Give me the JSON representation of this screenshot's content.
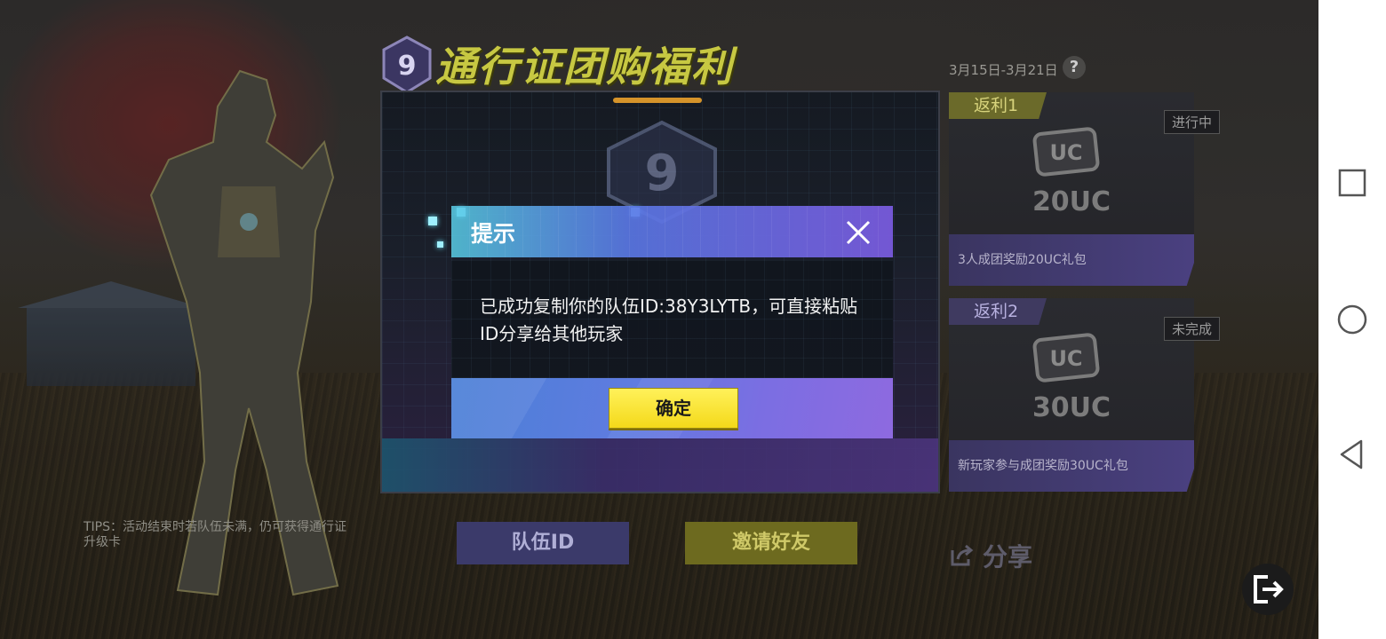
{
  "header": {
    "title": "通行证团购福利",
    "date_range": "3月15日-3月21日",
    "help_icon": "question-icon"
  },
  "rewards": [
    {
      "tag": "返利1",
      "status": "进行中",
      "amount": "20UC",
      "description": "3人成团奖励20UC礼包",
      "icon": "uc-icon"
    },
    {
      "tag": "返利2",
      "status": "未完成",
      "amount": "30UC",
      "description": "新玩家参与成团奖励30UC礼包",
      "icon": "uc-icon"
    }
  ],
  "tips": "TIPS：活动结束时若队伍未满，仍可获得通行证升级卡",
  "buttons": {
    "team_id": "队伍ID",
    "invite_friends": "邀请好友",
    "share": "分享"
  },
  "dialog": {
    "title": "提示",
    "message": "已成功复制你的队伍ID:38Y3LYTB，可直接粘贴ID分享给其他玩家",
    "confirm_label": "确定",
    "close_icon": "close-icon"
  },
  "colors": {
    "title_yellow": "#c7c842",
    "confirm_yellow": "#f4d91a",
    "dialog_header_start": "#58cde6",
    "dialog_header_end": "#785ad8"
  },
  "nav": {
    "recents_icon": "square-icon",
    "home_icon": "circle-icon",
    "back_icon": "triangle-back-icon"
  }
}
